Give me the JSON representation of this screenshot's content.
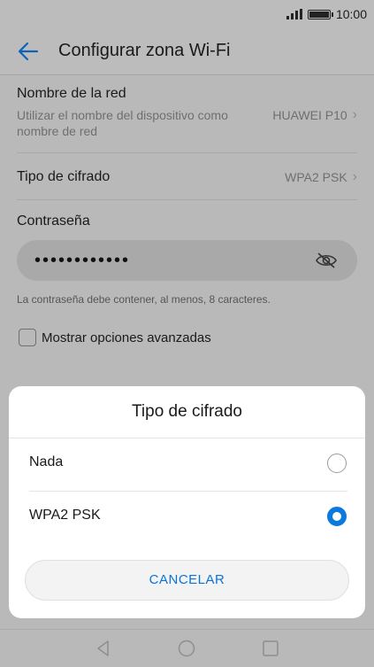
{
  "status_bar": {
    "time": "10:00",
    "battery_level": 1.0
  },
  "app_bar": {
    "title": "Configurar zona Wi-Fi"
  },
  "settings": {
    "network_name": {
      "title": "Nombre de la red",
      "subtitle": "Utilizar el nombre del dispositivo como nombre de red",
      "value": "HUAWEI P10"
    },
    "encryption": {
      "title": "Tipo de cifrado",
      "value": "WPA2 PSK"
    },
    "password": {
      "label": "Contraseña",
      "value": "••••••••••••",
      "hint": "La contraseña debe contener, al menos, 8 caracteres."
    },
    "advanced": {
      "label": "Mostrar opciones avanzadas",
      "checked": false
    }
  },
  "dialog": {
    "title": "Tipo de cifrado",
    "options": [
      {
        "label": "Nada",
        "selected": false
      },
      {
        "label": "WPA2 PSK",
        "selected": true
      }
    ],
    "cancel_label": "CANCELAR"
  },
  "colors": {
    "accent": "#0a7bdc",
    "cancel_text": "#0a74d6",
    "scrim": "#b9b9b9"
  },
  "icons": {
    "back": "arrow-left-icon",
    "eye": "eye-off-icon",
    "chevron": "chevron-right-icon",
    "nav_back": "triangle-back-icon",
    "nav_home": "circle-home-icon",
    "nav_recents": "square-recents-icon"
  }
}
